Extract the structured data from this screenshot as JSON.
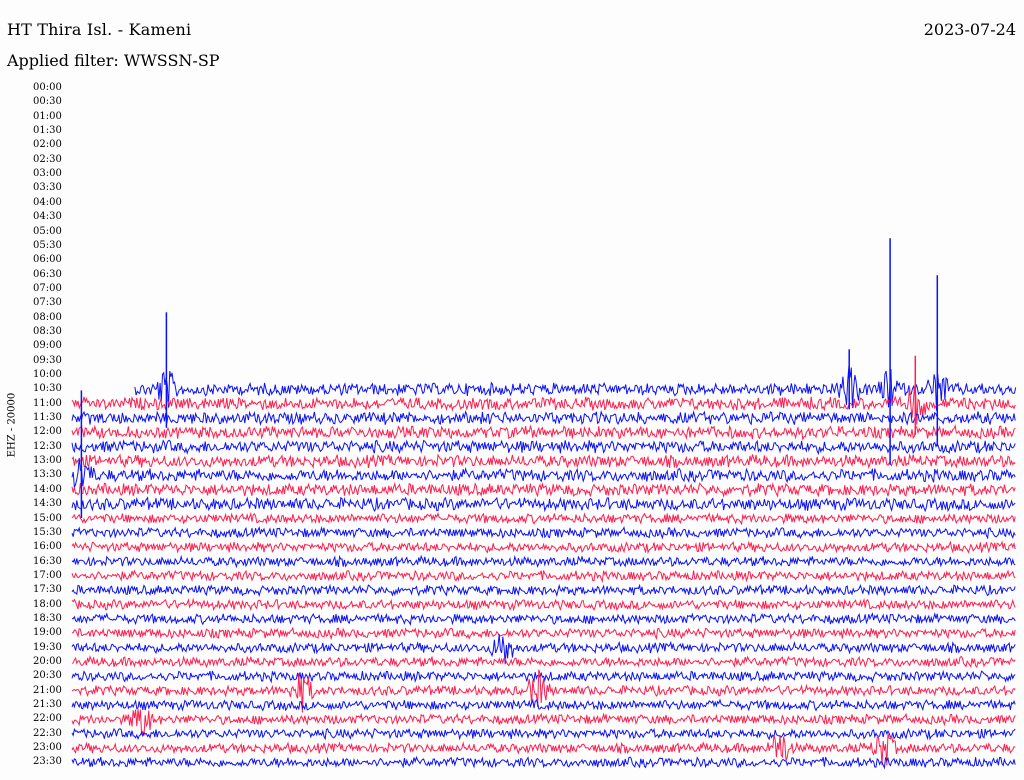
{
  "header": {
    "station": "HT Thira Isl. - Kameni",
    "date": "2023-07-24",
    "filter_prefix": "Applied filter: ",
    "filter_name": "WWSSN-SP"
  },
  "channel_label": "EHZ - 20000",
  "colors": {
    "trace_a": "#ff1e4e",
    "trace_b": "#0b12f5",
    "background": "#fdfdfd"
  },
  "chart_data": {
    "type": "line",
    "chart_kind": "helicorder",
    "rows": [
      "00:00",
      "00:30",
      "01:00",
      "01:30",
      "02:00",
      "02:30",
      "03:00",
      "03:30",
      "04:00",
      "04:30",
      "05:00",
      "05:30",
      "06:00",
      "06:30",
      "07:00",
      "07:30",
      "08:00",
      "08:30",
      "09:00",
      "09:30",
      "10:00",
      "10:30",
      "11:00",
      "11:30",
      "12:00",
      "12:30",
      "13:00",
      "13:30",
      "14:00",
      "14:30",
      "15:00",
      "15:30",
      "16:00",
      "16:30",
      "17:00",
      "17:30",
      "18:00",
      "18:30",
      "19:00",
      "19:30",
      "20:00",
      "20:30",
      "21:00",
      "21:30",
      "22:00",
      "22:30",
      "23:00",
      "23:30"
    ],
    "row_minutes": 30,
    "data_start_minute": 632,
    "series_colors": [
      "#ff1e4e",
      "#0b12f5"
    ],
    "events": [
      {
        "row": "10:30",
        "minute": 24.7
      },
      {
        "row": "10:30",
        "minute": 3.0
      },
      {
        "row": "10:30",
        "minute": 27.5
      },
      {
        "row": "10:30",
        "minute": 26.0
      },
      {
        "row": "11:00",
        "minute": 26.8
      },
      {
        "row": "13:30",
        "minute": 0.3
      },
      {
        "row": "19:30",
        "minute": 13.7
      },
      {
        "row": "21:00",
        "minute": 7.3
      },
      {
        "row": "21:00",
        "minute": 14.8
      },
      {
        "row": "22:00",
        "minute": 2.2
      },
      {
        "row": "23:00",
        "minute": 22.5
      },
      {
        "row": "23:00",
        "minute": 25.8
      }
    ]
  }
}
